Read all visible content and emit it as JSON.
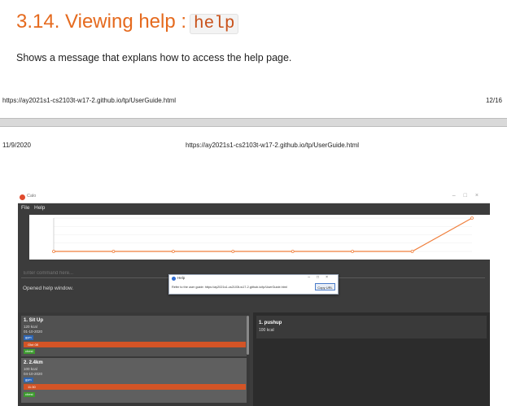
{
  "document": {
    "section_title": "3.14. Viewing help :",
    "section_code": "help",
    "section_description": "Shows a message that explans how to access the help page.",
    "footer_url": "https://ay2021s1-cs2103t-w17-2.github.io/tp/UserGuide.html",
    "footer_page": "12/16",
    "header_date": "11/9/2020",
    "header_url": "https://ay2021s1-cs2103t-w17-2.github.io/tp/UserGuide.html"
  },
  "app": {
    "window_title": "Calo",
    "menu": {
      "file": "File",
      "help": "Help"
    },
    "command_placeholder": "Enter command here...",
    "result_message": "Opened help window.",
    "exercise_list": [
      {
        "title": "1.  Sit Up",
        "calories": "120 kcal",
        "date": "01-10-2020",
        "tag1": "gym",
        "muscle": "Glut 08",
        "tag2": "chest"
      },
      {
        "title": "2.  2.4km",
        "calories": "100 kcal",
        "date": "04-10-2020",
        "tag1": "gym",
        "muscle": "11:30",
        "tag2": "chest"
      }
    ],
    "template_list": [
      {
        "title": "1.  pushup",
        "calories": "100 kcal"
      }
    ],
    "colors": {
      "accent": "#e56a1e",
      "line": "#f07f3c",
      "tag_blue": "#2f66b3",
      "tag_green": "#3d9a2f",
      "bar": "#d35426"
    }
  },
  "help_dialog": {
    "title": "Help",
    "message": "Refer to the user guide: https://ay2021s1-cs2103t-w17-2.github.io/tp/UserGuide.html",
    "copy_button": "Copy URL"
  },
  "chart_data": {
    "type": "line",
    "values": [
      0,
      0,
      0,
      0,
      0,
      0,
      0,
      8
    ],
    "ylim": [
      0,
      8
    ]
  }
}
